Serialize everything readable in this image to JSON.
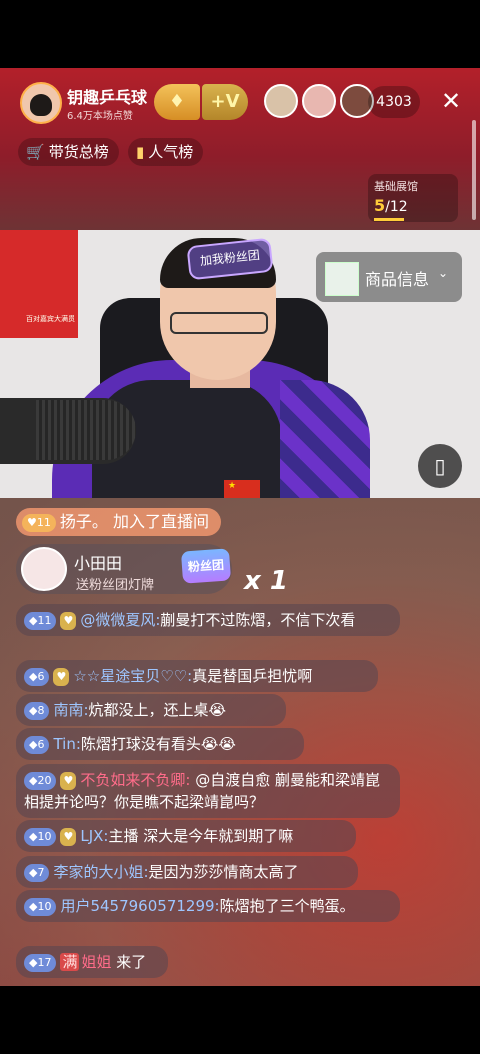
{
  "host": {
    "name": "钥趣乒乓球",
    "likes": "6.4万本场点赞",
    "follow_label": "+V",
    "viewer_count": "4303"
  },
  "ranks": {
    "sales": "带货总榜",
    "popular": "人气榜"
  },
  "hall": {
    "title": "基础展馆",
    "current": "5",
    "total": "/12"
  },
  "video": {
    "fan_tag": "加我粉丝团",
    "poster_text": "百对嘉宾大满贯"
  },
  "product": {
    "label": "商品信息"
  },
  "join_msg": {
    "level": "11",
    "text": "扬子。 加入了直播间"
  },
  "gift": {
    "name": "小田田",
    "action": "送粉丝团灯牌",
    "badge": "粉丝团",
    "count": "x 1"
  },
  "comments": [
    {
      "level": "11",
      "nick": "@微微夏风:",
      "text": "蒯曼打不过陈熠，不信下次看"
    },
    {
      "level": "6",
      "nick": "☆☆星途宝贝♡♡:",
      "text": "真是替国乒担忧啊"
    },
    {
      "level": "8",
      "nick": "南南:",
      "text": "炕都没上，还上桌😭"
    },
    {
      "level": "6",
      "nick": "Tin:",
      "text": "陈熠打球没有看头😭😭"
    },
    {
      "level": "20",
      "nick": "不负如来不负卿:",
      "text": "@自渡自愈 蒯曼能和梁靖崑相提并论吗？你是瞧不起梁靖崑吗？"
    },
    {
      "level": "10",
      "nick": "LJX:",
      "text": "主播 深大是今年就到期了嘛"
    },
    {
      "level": "7",
      "nick": "李家的大小姐:",
      "text": "是因为莎莎情商太高了"
    },
    {
      "level": "10",
      "nick": "用户5457960571299:",
      "text": "陈熠抱了三个鸭蛋。"
    },
    {
      "level": "17",
      "tag": "满",
      "nick": "姐姐",
      "text": "来了"
    }
  ]
}
